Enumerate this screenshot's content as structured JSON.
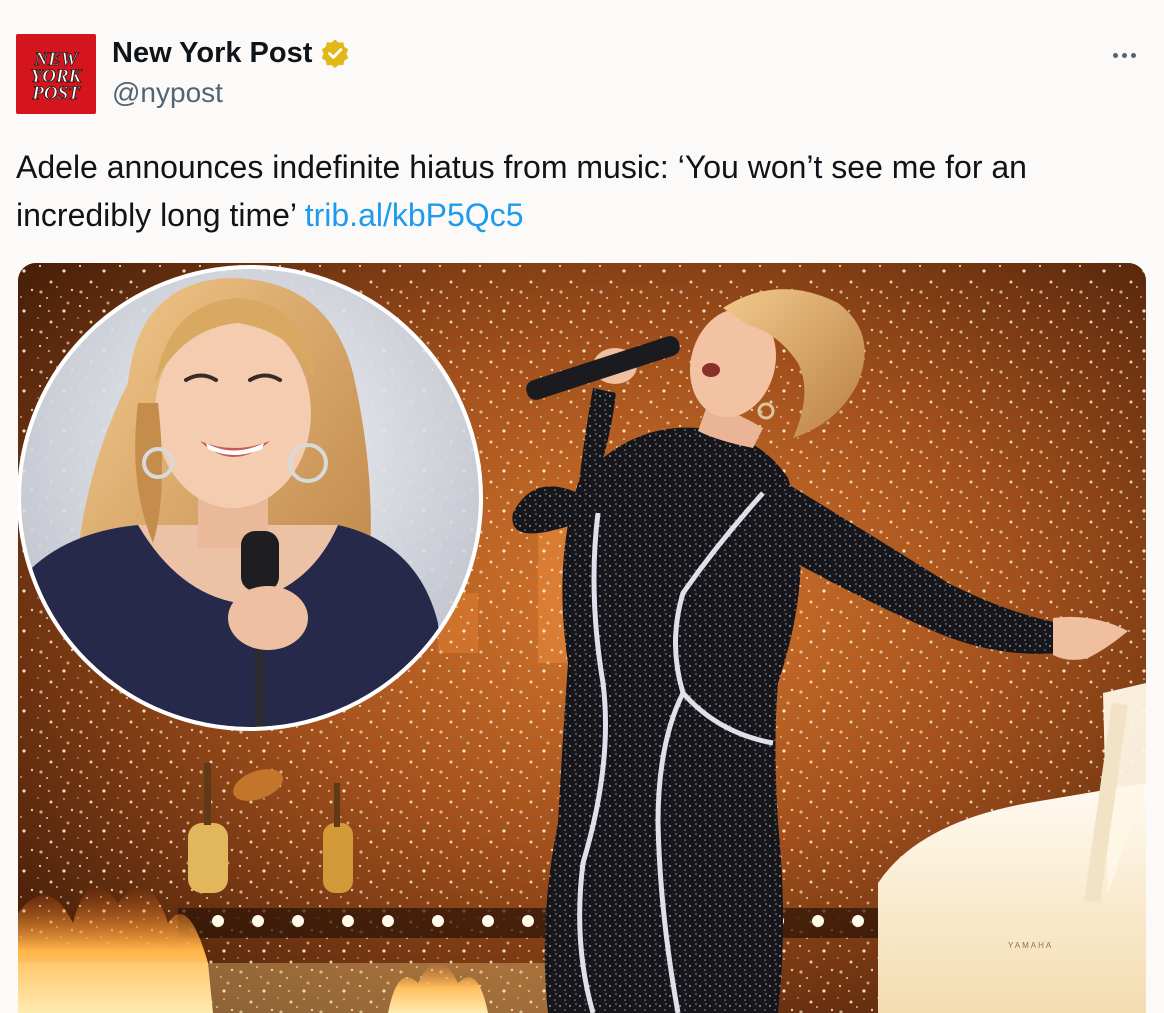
{
  "author": {
    "display_name": "New York Post",
    "handle": "@nypost",
    "logo_text": [
      "NEW",
      "YORK",
      "POST"
    ],
    "verified_badge": "gold-check-icon",
    "brand_color": "#d4151d"
  },
  "tweet": {
    "text": "Adele announces indefinite hiatus from music: ‘You won’t see me for an incredibly long time’ ",
    "link": "trib.al/kbP5Qc5",
    "link_color": "#1d9bf0"
  },
  "menu": {
    "icon": "more-horizontal-icon"
  },
  "media": {
    "piano_brand": "YAMAHA"
  }
}
